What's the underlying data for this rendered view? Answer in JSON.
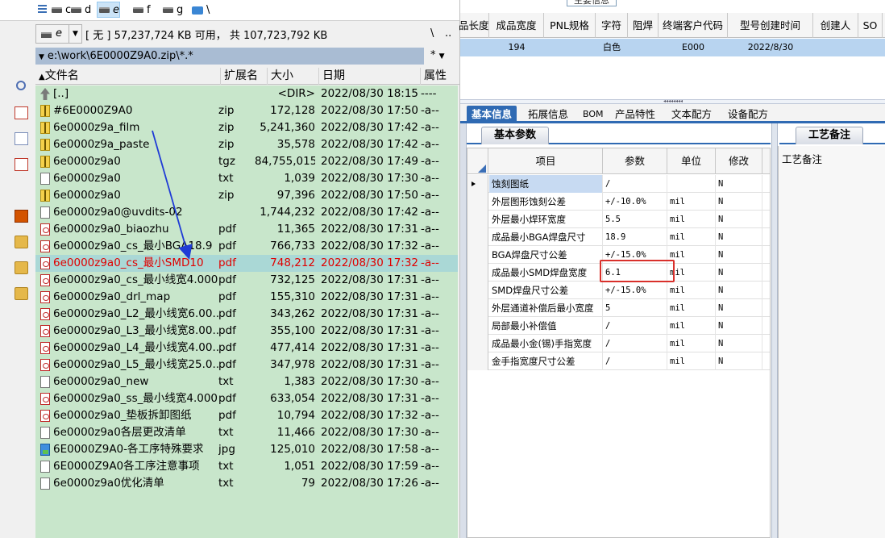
{
  "drives": [
    {
      "letter": "c",
      "active": false
    },
    {
      "letter": "d",
      "active": false
    },
    {
      "letter": "e",
      "active": true
    },
    {
      "letter": "f",
      "active": false
    },
    {
      "letter": "g",
      "active": false
    }
  ],
  "drive_net": "\\",
  "drive_combo": {
    "name": "e",
    "label": "[ 无 ]",
    "space": "57,237,724 KB 可用， 共 107,723,792 KB"
  },
  "nav": {
    "root": "\\",
    "up": ".."
  },
  "path": {
    "value": "e:\\work\\6E0000Z9A0.zip\\*.*",
    "filter": "*"
  },
  "file_columns": {
    "name": "文件名",
    "ext": "扩展名",
    "size": "大小",
    "date": "日期",
    "attr": "属性"
  },
  "files": [
    {
      "name": "[..]",
      "ext": "",
      "size": "<DIR>",
      "date": "2022/08/30 18:15",
      "attr": "----",
      "icon": "up"
    },
    {
      "name": "#6E0000Z9A0",
      "ext": "zip",
      "size": "172,128",
      "date": "2022/08/30 17:50",
      "attr": "-a--",
      "icon": "zip"
    },
    {
      "name": "6e0000z9a_film",
      "ext": "zip",
      "size": "5,241,360",
      "date": "2022/08/30 17:42",
      "attr": "-a--",
      "icon": "zip"
    },
    {
      "name": "6e0000z9a_paste",
      "ext": "zip",
      "size": "35,578",
      "date": "2022/08/30 17:42",
      "attr": "-a--",
      "icon": "zip"
    },
    {
      "name": "6e0000z9a0",
      "ext": "tgz",
      "size": "84,755,015",
      "date": "2022/08/30 17:49",
      "attr": "-a--",
      "icon": "zip"
    },
    {
      "name": "6e0000z9a0",
      "ext": "txt",
      "size": "1,039",
      "date": "2022/08/30 17:30",
      "attr": "-a--",
      "icon": "txt"
    },
    {
      "name": "6e0000z9a0",
      "ext": "zip",
      "size": "97,396",
      "date": "2022/08/30 17:50",
      "attr": "-a--",
      "icon": "zip"
    },
    {
      "name": "6e0000z9a0@uvdits-02",
      "ext": "",
      "size": "1,744,232",
      "date": "2022/08/30 17:42",
      "attr": "-a--",
      "icon": "txt"
    },
    {
      "name": "6e0000z9a0_biaozhu",
      "ext": "pdf",
      "size": "11,365",
      "date": "2022/08/30 17:31",
      "attr": "-a--",
      "icon": "pdf"
    },
    {
      "name": "6e0000z9a0_cs_最小BGA18.9",
      "ext": "pdf",
      "size": "766,733",
      "date": "2022/08/30 17:32",
      "attr": "-a--",
      "icon": "pdf"
    },
    {
      "name": "6e0000z9a0_cs_最小SMD10",
      "ext": "pdf",
      "size": "748,212",
      "date": "2022/08/30 17:32",
      "attr": "-a--",
      "icon": "pdf",
      "selected": true
    },
    {
      "name": "6e0000z9a0_cs_最小线宽4.000",
      "ext": "pdf",
      "size": "732,125",
      "date": "2022/08/30 17:31",
      "attr": "-a--",
      "icon": "pdf"
    },
    {
      "name": "6e0000z9a0_drl_map",
      "ext": "pdf",
      "size": "155,310",
      "date": "2022/08/30 17:31",
      "attr": "-a--",
      "icon": "pdf"
    },
    {
      "name": "6e0000z9a0_L2_最小线宽6.00..",
      "ext": "pdf",
      "size": "343,262",
      "date": "2022/08/30 17:31",
      "attr": "-a--",
      "icon": "pdf"
    },
    {
      "name": "6e0000z9a0_L3_最小线宽8.00..",
      "ext": "pdf",
      "size": "355,100",
      "date": "2022/08/30 17:31",
      "attr": "-a--",
      "icon": "pdf"
    },
    {
      "name": "6e0000z9a0_L4_最小线宽4.00..",
      "ext": "pdf",
      "size": "477,414",
      "date": "2022/08/30 17:31",
      "attr": "-a--",
      "icon": "pdf"
    },
    {
      "name": "6e0000z9a0_L5_最小线宽25.0..",
      "ext": "pdf",
      "size": "347,978",
      "date": "2022/08/30 17:31",
      "attr": "-a--",
      "icon": "pdf"
    },
    {
      "name": "6e0000z9a0_new",
      "ext": "txt",
      "size": "1,383",
      "date": "2022/08/30 17:30",
      "attr": "-a--",
      "icon": "txt"
    },
    {
      "name": "6e0000z9a0_ss_最小线宽4.000",
      "ext": "pdf",
      "size": "633,054",
      "date": "2022/08/30 17:31",
      "attr": "-a--",
      "icon": "pdf"
    },
    {
      "name": "6e0000z9a0_垫板拆卸图纸",
      "ext": "pdf",
      "size": "10,794",
      "date": "2022/08/30 17:32",
      "attr": "-a--",
      "icon": "pdf"
    },
    {
      "name": "6e0000z9a0各层更改清单",
      "ext": "txt",
      "size": "11,466",
      "date": "2022/08/30 17:30",
      "attr": "-a--",
      "icon": "txt"
    },
    {
      "name": "6E0000Z9A0-各工序特殊要求",
      "ext": "jpg",
      "size": "125,010",
      "date": "2022/08/30 17:58",
      "attr": "-a--",
      "icon": "jpg"
    },
    {
      "name": "6E0000Z9A0各工序注意事项",
      "ext": "txt",
      "size": "1,051",
      "date": "2022/08/30 17:59",
      "attr": "-a--",
      "icon": "txt"
    },
    {
      "name": "6e0000z9a0优化清单",
      "ext": "txt",
      "size": "79",
      "date": "2022/08/30 17:26",
      "attr": "-a--",
      "icon": "txt"
    }
  ],
  "top_grid": {
    "title": "主要信息",
    "headers": [
      "品长度",
      "成品宽度",
      "PNL规格",
      "字符",
      "阻焊",
      "终端客户代码",
      "型号创建时间",
      "创建人",
      "SO"
    ],
    "row": [
      "",
      "194",
      "",
      "白色",
      "",
      "E000",
      "2022/8/30",
      "",
      ""
    ]
  },
  "tabs": [
    "基本信息",
    "拓展信息",
    "BOM",
    "产品特性",
    "文本配方",
    "设备配方"
  ],
  "active_tab": "基本信息",
  "param_section": {
    "title": "基本参数",
    "headers": {
      "item": "项目",
      "value": "参数",
      "unit": "单位",
      "modify": "修改"
    },
    "rows": [
      {
        "item": "蚀刻图纸",
        "value": "/",
        "unit": "",
        "modify": "N",
        "current": true
      },
      {
        "item": "外层图形蚀刻公差",
        "value": "+/-10.0%",
        "unit": "mil",
        "modify": "N"
      },
      {
        "item": "外层最小焊环宽度",
        "value": "5.5",
        "unit": "mil",
        "modify": "N"
      },
      {
        "item": "成品最小BGA焊盘尺寸",
        "value": "18.9",
        "unit": "mil",
        "modify": "N"
      },
      {
        "item": "BGA焊盘尺寸公差",
        "value": "+/-15.0%",
        "unit": "mil",
        "modify": "N"
      },
      {
        "item": "成品最小SMD焊盘宽度",
        "value": "6.1",
        "unit": "mil",
        "modify": "N",
        "highlight": true
      },
      {
        "item": "SMD焊盘尺寸公差",
        "value": "+/-15.0%",
        "unit": "mil",
        "modify": "N"
      },
      {
        "item": "外层通道补偿后最小宽度",
        "value": "5",
        "unit": "mil",
        "modify": "N"
      },
      {
        "item": "局部最小补偿值",
        "value": "/",
        "unit": "mil",
        "modify": "N"
      },
      {
        "item": "成品最小金(锡)手指宽度",
        "value": "/",
        "unit": "mil",
        "modify": "N"
      },
      {
        "item": "金手指宽度尺寸公差",
        "value": "/",
        "unit": "mil",
        "modify": "N"
      }
    ]
  },
  "notes": {
    "tab": "工艺备注",
    "label": "工艺备注"
  },
  "colors": {
    "file_list_bg": "#c8e6cb",
    "selected_row": "#aad8d6",
    "selected_text": "#e00000",
    "tab_active": "#2f6ab3",
    "highlight_box": "#d9302b",
    "arrow": "#1f3bd6"
  }
}
